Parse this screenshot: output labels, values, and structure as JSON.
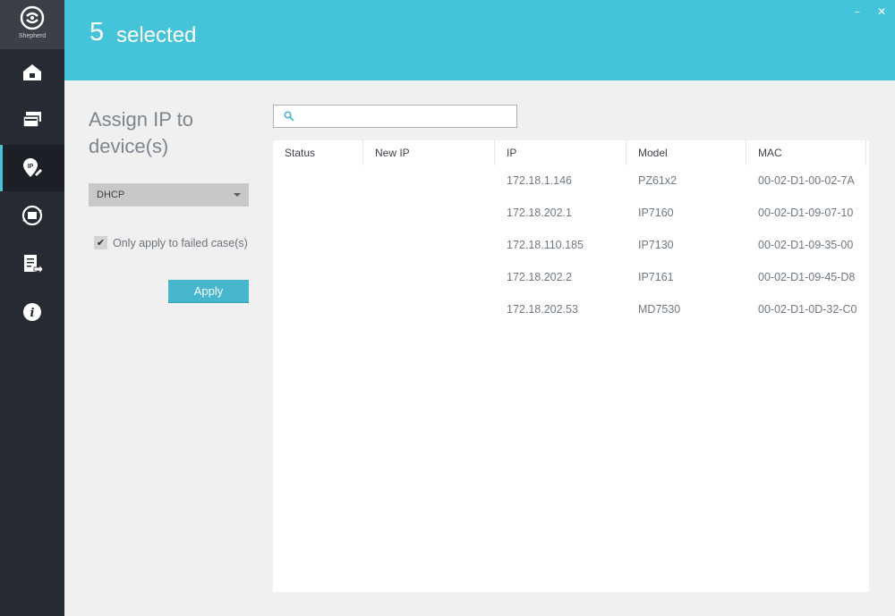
{
  "app": {
    "logo_text": "Shepherd"
  },
  "header": {
    "count": "5",
    "label": "selected",
    "controls": {
      "minimize": "–",
      "close": "✕"
    }
  },
  "sidebar": {
    "items": [
      {
        "name": "home",
        "icon": "home-icon",
        "active": false
      },
      {
        "name": "devices",
        "icon": "devices-icon",
        "active": false
      },
      {
        "name": "assign-ip",
        "icon": "ip-pin-icon",
        "active": true
      },
      {
        "name": "sync",
        "icon": "sync-icon",
        "active": false
      },
      {
        "name": "export",
        "icon": "export-icon",
        "active": false
      },
      {
        "name": "info",
        "icon": "info-icon",
        "active": false
      }
    ]
  },
  "panel": {
    "title_line1": "Assign IP to",
    "title_line2": "device(s)",
    "mode": {
      "selected": "DHCP"
    },
    "checkbox": {
      "label": "Only apply to failed case(s)",
      "checked": true
    },
    "apply_label": "Apply"
  },
  "search": {
    "value": "",
    "placeholder": ""
  },
  "table": {
    "columns": [
      "Status",
      "New IP",
      "IP",
      "Model",
      "MAC"
    ],
    "rows": [
      {
        "status": "",
        "new_ip": "",
        "ip": "172.18.1.146",
        "model": "PZ61x2",
        "mac": "00-02-D1-00-02-7A"
      },
      {
        "status": "",
        "new_ip": "",
        "ip": "172.18.202.1",
        "model": "IP7160",
        "mac": "00-02-D1-09-07-10"
      },
      {
        "status": "",
        "new_ip": "",
        "ip": "172.18.110.185",
        "model": "IP7130",
        "mac": "00-02-D1-09-35-00"
      },
      {
        "status": "",
        "new_ip": "",
        "ip": "172.18.202.2",
        "model": "IP7161",
        "mac": "00-02-D1-09-45-D8"
      },
      {
        "status": "",
        "new_ip": "",
        "ip": "172.18.202.53",
        "model": "MD7530",
        "mac": "00-02-D1-0D-32-C0"
      }
    ]
  },
  "colors": {
    "accent": "#45c3d8",
    "sidebar": "#262a33",
    "button": "#45b6cc"
  }
}
